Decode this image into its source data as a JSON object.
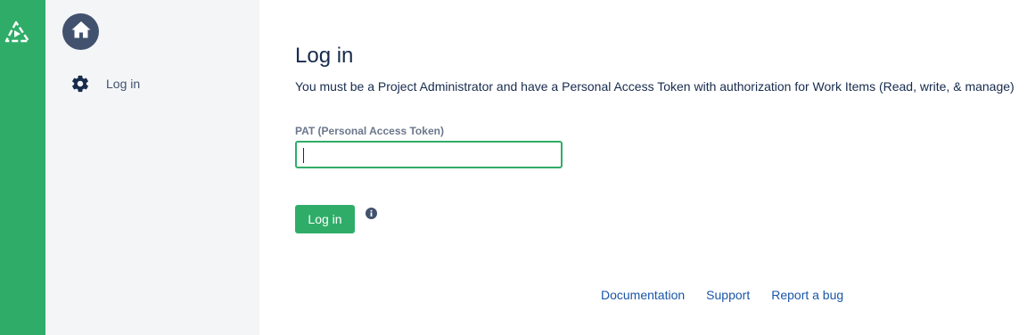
{
  "rail": {
    "logo_icon": "app-logo-icon"
  },
  "sidebar": {
    "home_icon": "home-icon",
    "items": [
      {
        "label": "Log in",
        "icon": "gear-icon"
      }
    ]
  },
  "main": {
    "title": "Log in",
    "subtitle": "You must be a Project Administrator and have a Personal Access Token with authorization for Work Items (Read, write, & manage)",
    "pat_field": {
      "label": "PAT (Personal Access Token)",
      "value": "",
      "placeholder": ""
    },
    "login_button_label": "Log in",
    "info_icon": "info-icon"
  },
  "footer": {
    "links": [
      "Documentation",
      "Support",
      "Report a bug"
    ]
  },
  "colors": {
    "accent": "#2fad68",
    "sidebar_bg": "#f4f5f7",
    "home_button": "#42526e",
    "link": "#1a56a8"
  }
}
